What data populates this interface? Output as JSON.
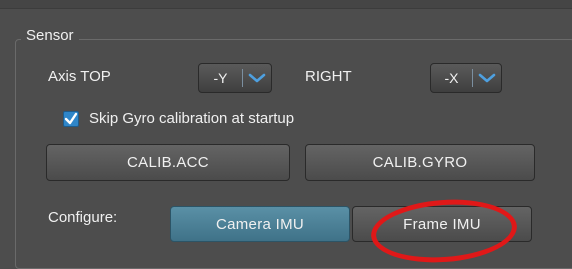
{
  "sensor": {
    "title": "Sensor",
    "axis_top_label": "Axis TOP",
    "axis_top_value": "-Y",
    "right_label": "RIGHT",
    "right_value": "-X",
    "skip_gyro_label": "Skip Gyro calibration at startup",
    "skip_gyro_checked": true,
    "calib_acc_label": "CALIB.ACC",
    "calib_gyro_label": "CALIB.GYRO",
    "configure_label": "Configure:",
    "camera_imu_label": "Camera IMU",
    "frame_imu_label": "Frame IMU"
  },
  "colors": {
    "accent": "#2f86c9",
    "active_button": "#4a7f95",
    "highlight_ring": "#e01818"
  },
  "icons": {
    "dropdown": "chevron-down-icon",
    "check": "checkmark-icon"
  }
}
